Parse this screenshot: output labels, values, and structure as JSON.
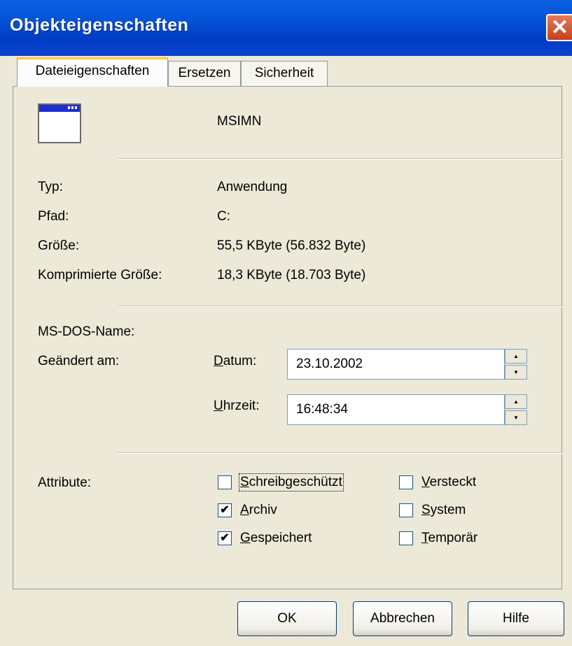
{
  "window": {
    "title": "Objekteigenschaften",
    "close_glyph": "✕"
  },
  "tabs": [
    {
      "label": "Dateieigenschaften",
      "active": true
    },
    {
      "label": "Ersetzen",
      "active": false
    },
    {
      "label": "Sicherheit",
      "active": false
    }
  ],
  "file": {
    "name": "MSIMN",
    "icon": "application-window-icon"
  },
  "details": {
    "type_label": "Typ:",
    "type_value": "Anwendung",
    "path_label": "Pfad:",
    "path_value": "C:",
    "size_label": "Größe:",
    "size_value": "55,5 KByte (56.832 Byte)",
    "compressed_label": "Komprimierte Größe:",
    "compressed_value": "18,3 KByte (18.703 Byte)"
  },
  "msdos_label": "MS-DOS-Name:",
  "modified": {
    "label": "Geändert am:",
    "date_label_u": "D",
    "date_label_rest": "atum:",
    "date_value": "23.10.2002",
    "time_label_u": "U",
    "time_label_rest": "hrzeit:",
    "time_value": "16:48:34",
    "spin_up": "▲",
    "spin_down": "▼"
  },
  "attributes": {
    "label": "Attribute:",
    "check_mark": "✔",
    "items": [
      {
        "u": "S",
        "rest": "chreibgeschützt",
        "checked": false
      },
      {
        "u": "A",
        "rest": "rchiv",
        "checked": true
      },
      {
        "u": "G",
        "rest": "espeichert",
        "checked": true
      },
      {
        "u": "V",
        "rest": "ersteckt",
        "checked": false
      },
      {
        "u": "S",
        "rest": "ystem",
        "checked": false
      },
      {
        "u": "T",
        "rest": "emporär",
        "checked": false
      }
    ]
  },
  "buttons": {
    "ok": "OK",
    "cancel": "Abbrechen",
    "help": "Hilfe"
  }
}
